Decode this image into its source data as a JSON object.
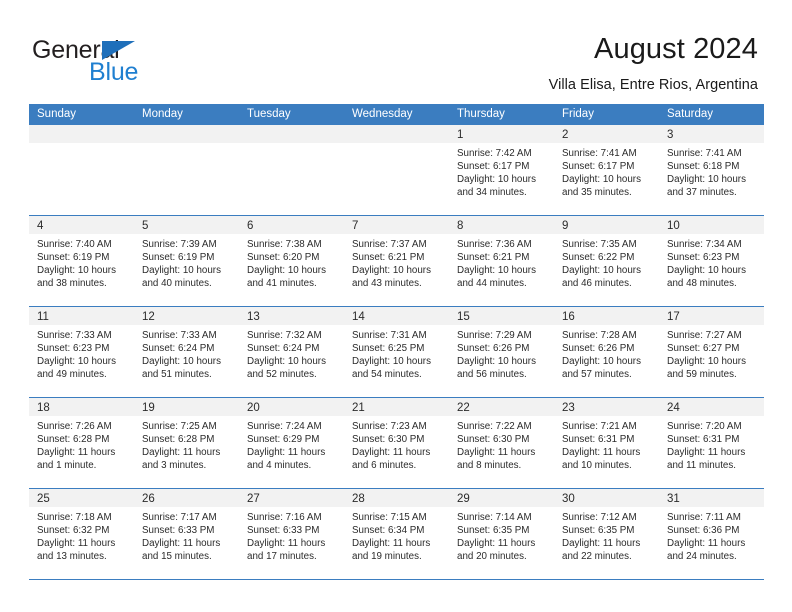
{
  "brand": {
    "name_first": "General",
    "name_second": "Blue",
    "triangle_color": "#1f6fba",
    "blue_color": "#1f7fd0"
  },
  "header": {
    "title": "August 2024",
    "location": "Villa Elisa, Entre Rios, Argentina",
    "header_bg": "#3b7dc0"
  },
  "weekdays": [
    "Sunday",
    "Monday",
    "Tuesday",
    "Wednesday",
    "Thursday",
    "Friday",
    "Saturday"
  ],
  "weeks": [
    [
      {
        "day": "",
        "sunrise": "",
        "sunset": "",
        "daylight1": "",
        "daylight2": ""
      },
      {
        "day": "",
        "sunrise": "",
        "sunset": "",
        "daylight1": "",
        "daylight2": ""
      },
      {
        "day": "",
        "sunrise": "",
        "sunset": "",
        "daylight1": "",
        "daylight2": ""
      },
      {
        "day": "",
        "sunrise": "",
        "sunset": "",
        "daylight1": "",
        "daylight2": ""
      },
      {
        "day": "1",
        "sunrise": "Sunrise: 7:42 AM",
        "sunset": "Sunset: 6:17 PM",
        "daylight1": "Daylight: 10 hours",
        "daylight2": "and 34 minutes."
      },
      {
        "day": "2",
        "sunrise": "Sunrise: 7:41 AM",
        "sunset": "Sunset: 6:17 PM",
        "daylight1": "Daylight: 10 hours",
        "daylight2": "and 35 minutes."
      },
      {
        "day": "3",
        "sunrise": "Sunrise: 7:41 AM",
        "sunset": "Sunset: 6:18 PM",
        "daylight1": "Daylight: 10 hours",
        "daylight2": "and 37 minutes."
      }
    ],
    [
      {
        "day": "4",
        "sunrise": "Sunrise: 7:40 AM",
        "sunset": "Sunset: 6:19 PM",
        "daylight1": "Daylight: 10 hours",
        "daylight2": "and 38 minutes."
      },
      {
        "day": "5",
        "sunrise": "Sunrise: 7:39 AM",
        "sunset": "Sunset: 6:19 PM",
        "daylight1": "Daylight: 10 hours",
        "daylight2": "and 40 minutes."
      },
      {
        "day": "6",
        "sunrise": "Sunrise: 7:38 AM",
        "sunset": "Sunset: 6:20 PM",
        "daylight1": "Daylight: 10 hours",
        "daylight2": "and 41 minutes."
      },
      {
        "day": "7",
        "sunrise": "Sunrise: 7:37 AM",
        "sunset": "Sunset: 6:21 PM",
        "daylight1": "Daylight: 10 hours",
        "daylight2": "and 43 minutes."
      },
      {
        "day": "8",
        "sunrise": "Sunrise: 7:36 AM",
        "sunset": "Sunset: 6:21 PM",
        "daylight1": "Daylight: 10 hours",
        "daylight2": "and 44 minutes."
      },
      {
        "day": "9",
        "sunrise": "Sunrise: 7:35 AM",
        "sunset": "Sunset: 6:22 PM",
        "daylight1": "Daylight: 10 hours",
        "daylight2": "and 46 minutes."
      },
      {
        "day": "10",
        "sunrise": "Sunrise: 7:34 AM",
        "sunset": "Sunset: 6:23 PM",
        "daylight1": "Daylight: 10 hours",
        "daylight2": "and 48 minutes."
      }
    ],
    [
      {
        "day": "11",
        "sunrise": "Sunrise: 7:33 AM",
        "sunset": "Sunset: 6:23 PM",
        "daylight1": "Daylight: 10 hours",
        "daylight2": "and 49 minutes."
      },
      {
        "day": "12",
        "sunrise": "Sunrise: 7:33 AM",
        "sunset": "Sunset: 6:24 PM",
        "daylight1": "Daylight: 10 hours",
        "daylight2": "and 51 minutes."
      },
      {
        "day": "13",
        "sunrise": "Sunrise: 7:32 AM",
        "sunset": "Sunset: 6:24 PM",
        "daylight1": "Daylight: 10 hours",
        "daylight2": "and 52 minutes."
      },
      {
        "day": "14",
        "sunrise": "Sunrise: 7:31 AM",
        "sunset": "Sunset: 6:25 PM",
        "daylight1": "Daylight: 10 hours",
        "daylight2": "and 54 minutes."
      },
      {
        "day": "15",
        "sunrise": "Sunrise: 7:29 AM",
        "sunset": "Sunset: 6:26 PM",
        "daylight1": "Daylight: 10 hours",
        "daylight2": "and 56 minutes."
      },
      {
        "day": "16",
        "sunrise": "Sunrise: 7:28 AM",
        "sunset": "Sunset: 6:26 PM",
        "daylight1": "Daylight: 10 hours",
        "daylight2": "and 57 minutes."
      },
      {
        "day": "17",
        "sunrise": "Sunrise: 7:27 AM",
        "sunset": "Sunset: 6:27 PM",
        "daylight1": "Daylight: 10 hours",
        "daylight2": "and 59 minutes."
      }
    ],
    [
      {
        "day": "18",
        "sunrise": "Sunrise: 7:26 AM",
        "sunset": "Sunset: 6:28 PM",
        "daylight1": "Daylight: 11 hours",
        "daylight2": "and 1 minute."
      },
      {
        "day": "19",
        "sunrise": "Sunrise: 7:25 AM",
        "sunset": "Sunset: 6:28 PM",
        "daylight1": "Daylight: 11 hours",
        "daylight2": "and 3 minutes."
      },
      {
        "day": "20",
        "sunrise": "Sunrise: 7:24 AM",
        "sunset": "Sunset: 6:29 PM",
        "daylight1": "Daylight: 11 hours",
        "daylight2": "and 4 minutes."
      },
      {
        "day": "21",
        "sunrise": "Sunrise: 7:23 AM",
        "sunset": "Sunset: 6:30 PM",
        "daylight1": "Daylight: 11 hours",
        "daylight2": "and 6 minutes."
      },
      {
        "day": "22",
        "sunrise": "Sunrise: 7:22 AM",
        "sunset": "Sunset: 6:30 PM",
        "daylight1": "Daylight: 11 hours",
        "daylight2": "and 8 minutes."
      },
      {
        "day": "23",
        "sunrise": "Sunrise: 7:21 AM",
        "sunset": "Sunset: 6:31 PM",
        "daylight1": "Daylight: 11 hours",
        "daylight2": "and 10 minutes."
      },
      {
        "day": "24",
        "sunrise": "Sunrise: 7:20 AM",
        "sunset": "Sunset: 6:31 PM",
        "daylight1": "Daylight: 11 hours",
        "daylight2": "and 11 minutes."
      }
    ],
    [
      {
        "day": "25",
        "sunrise": "Sunrise: 7:18 AM",
        "sunset": "Sunset: 6:32 PM",
        "daylight1": "Daylight: 11 hours",
        "daylight2": "and 13 minutes."
      },
      {
        "day": "26",
        "sunrise": "Sunrise: 7:17 AM",
        "sunset": "Sunset: 6:33 PM",
        "daylight1": "Daylight: 11 hours",
        "daylight2": "and 15 minutes."
      },
      {
        "day": "27",
        "sunrise": "Sunrise: 7:16 AM",
        "sunset": "Sunset: 6:33 PM",
        "daylight1": "Daylight: 11 hours",
        "daylight2": "and 17 minutes."
      },
      {
        "day": "28",
        "sunrise": "Sunrise: 7:15 AM",
        "sunset": "Sunset: 6:34 PM",
        "daylight1": "Daylight: 11 hours",
        "daylight2": "and 19 minutes."
      },
      {
        "day": "29",
        "sunrise": "Sunrise: 7:14 AM",
        "sunset": "Sunset: 6:35 PM",
        "daylight1": "Daylight: 11 hours",
        "daylight2": "and 20 minutes."
      },
      {
        "day": "30",
        "sunrise": "Sunrise: 7:12 AM",
        "sunset": "Sunset: 6:35 PM",
        "daylight1": "Daylight: 11 hours",
        "daylight2": "and 22 minutes."
      },
      {
        "day": "31",
        "sunrise": "Sunrise: 7:11 AM",
        "sunset": "Sunset: 6:36 PM",
        "daylight1": "Daylight: 11 hours",
        "daylight2": "and 24 minutes."
      }
    ]
  ]
}
